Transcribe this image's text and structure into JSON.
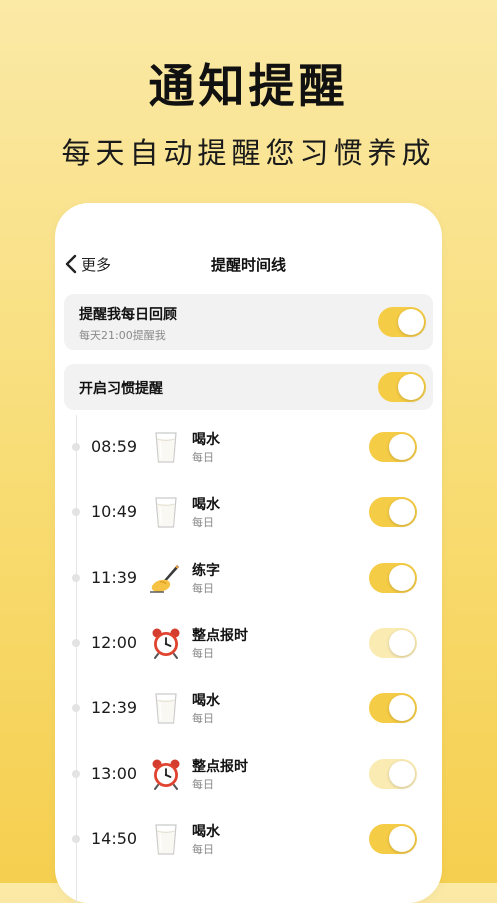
{
  "hero": {
    "title": "通知提醒",
    "subtitle": "每天自动提醒您习惯养成"
  },
  "nav": {
    "back_label": "更多",
    "title": "提醒时间线"
  },
  "daily_review": {
    "title": "提醒我每日回顾",
    "subtitle": "每天21:00提醒我",
    "enabled": true
  },
  "habit_reminder": {
    "title": "开启习惯提醒",
    "enabled": true
  },
  "timeline": [
    {
      "time": "08:59",
      "icon": "milk-glass-icon",
      "name": "喝水",
      "freq": "每日",
      "enabled": true
    },
    {
      "time": "10:49",
      "icon": "milk-glass-icon",
      "name": "喝水",
      "freq": "每日",
      "enabled": true
    },
    {
      "time": "11:39",
      "icon": "writing-hand-icon",
      "name": "练字",
      "freq": "每日",
      "enabled": true
    },
    {
      "time": "12:00",
      "icon": "alarm-clock-icon",
      "name": "整点报时",
      "freq": "每日",
      "enabled": false
    },
    {
      "time": "12:39",
      "icon": "milk-glass-icon",
      "name": "喝水",
      "freq": "每日",
      "enabled": true
    },
    {
      "time": "13:00",
      "icon": "alarm-clock-icon",
      "name": "整点报时",
      "freq": "每日",
      "enabled": false
    },
    {
      "time": "14:50",
      "icon": "milk-glass-icon",
      "name": "喝水",
      "freq": "每日",
      "enabled": true
    }
  ],
  "colors": {
    "accent": "#f5cc46",
    "accent_disabled": "#faebb3",
    "card_bg": "#f2f2f2",
    "background_top": "#fbe9a6",
    "background_bottom": "#f5cf4f"
  }
}
